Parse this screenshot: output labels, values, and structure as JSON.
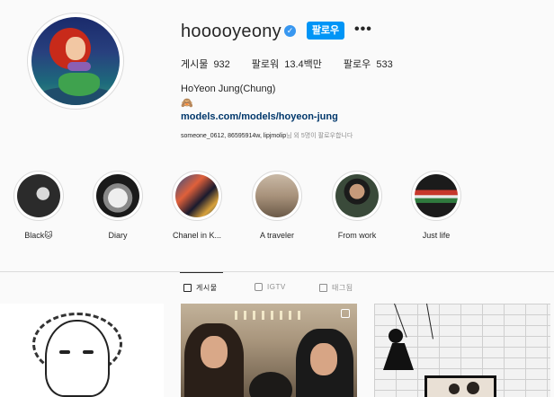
{
  "profile": {
    "username": "hooooyeony",
    "verified_icon": "verified-badge-icon",
    "follow_label": "팔로우",
    "more_label": "•••",
    "stats": [
      {
        "label": "게시물",
        "value": "932"
      },
      {
        "label": "팔로워",
        "value": "13.4백만"
      },
      {
        "label": "팔로우",
        "value": "533"
      }
    ],
    "full_name": "HoYeon Jung(Chung)",
    "bio_emoji": "🙈",
    "link": "models.com/models/hoyeon-jung",
    "followed_by_names": "someone_0612, 86595914w, lipjmolip",
    "followed_by_suffix": "님 외 5명이 팔로우합니다"
  },
  "highlights": [
    {
      "label": "Black🐱"
    },
    {
      "label": "Diary"
    },
    {
      "label": "Chanel in K..."
    },
    {
      "label": "A traveler"
    },
    {
      "label": "From work"
    },
    {
      "label": "Just life"
    }
  ],
  "tabs": [
    {
      "label": "게시물",
      "icon": "grid-icon",
      "active": true
    },
    {
      "label": "IGTV",
      "icon": "igtv-icon",
      "active": false
    },
    {
      "label": "태그됨",
      "icon": "tagged-icon",
      "active": false
    }
  ],
  "colors": {
    "accent": "#0095f6",
    "verified": "#3897f0",
    "link": "#00376b",
    "muted": "#8e8e8e",
    "border": "#dbdbdb"
  }
}
